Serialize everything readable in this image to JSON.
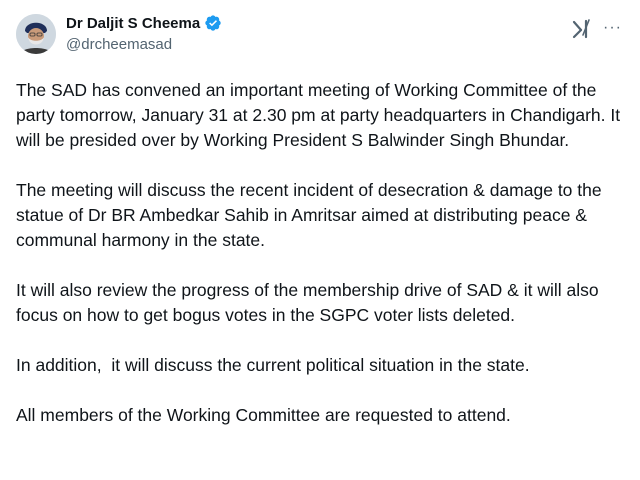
{
  "author": {
    "display_name": "Dr Daljit S Cheema",
    "handle": "@drcheemasad",
    "verified": true,
    "avatar_icon": "profile-avatar"
  },
  "header_icons": {
    "grok": "grok-icon",
    "more": "more-icon",
    "more_glyph": "···"
  },
  "colors": {
    "text": "#0f1419",
    "secondary": "#536471",
    "verified": "#1d9bf0"
  },
  "tweet": {
    "paragraphs": [
      "The SAD has convened an important meeting of Working Committee of the party tomorrow, January 31 at 2.30 pm at party headquarters in Chandigarh. It will be presided over by Working President S Balwinder Singh Bhundar.",
      "The meeting will discuss the recent incident of desecration & damage to the statue of Dr BR Ambedkar Sahib in Amritsar aimed at distributing peace & communal harmony in the state.",
      "It will also review the progress of the membership drive of SAD & it will also focus on how to get bogus votes in the SGPC voter lists deleted.",
      "In addition,  it will discuss the current political situation in the state.",
      "All members of the Working Committee are requested to attend."
    ]
  }
}
